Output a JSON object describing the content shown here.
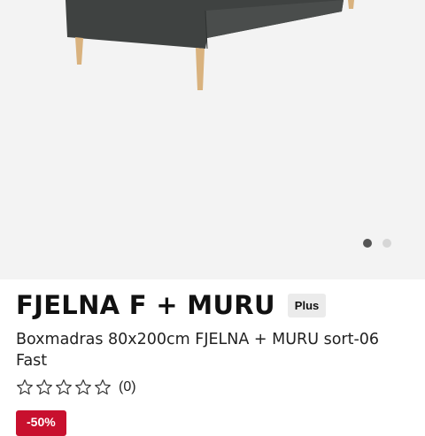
{
  "product": {
    "title": "FJELNA F + MURU",
    "badge": "Plus",
    "subtitle": "Boxmadras 80x200cm FJELNA + MURU sort-06 Fast",
    "rating": {
      "stars": 0,
      "max": 5,
      "count_label": "(0)"
    },
    "discount": "-50%"
  },
  "gallery": {
    "slides": 2,
    "active_index": 0
  },
  "icons": {
    "star": "star-outline-icon"
  },
  "colors": {
    "accent": "#c8102e",
    "fabric": "#3f4241"
  }
}
